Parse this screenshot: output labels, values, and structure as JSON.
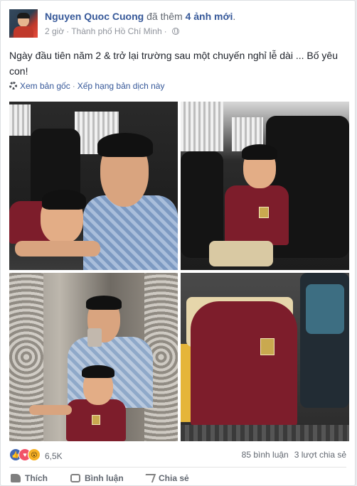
{
  "post": {
    "author": "Nguyen Quoc Cuong",
    "action_prefix": "đã thêm",
    "action_count": "4 ảnh mới",
    "action_suffix": ".",
    "time": "2 giờ",
    "location": "Thành phố Hồ Chí Minh",
    "privacy_icon": "globe-icon",
    "caption": "Ngày đầu tiên năm 2 & trở lại trường sau một chuyến nghỉ lễ dài ... Bố yêu con!"
  },
  "translation": {
    "see_original": "Xem bản gốc",
    "separator": "·",
    "rate_translation": "Xếp hạng bản dịch này"
  },
  "stats": {
    "reactions": [
      "like",
      "love",
      "wow"
    ],
    "reaction_count": "6,5K",
    "comments": "85 bình luận",
    "shares": "3 lượt chia sẻ"
  },
  "actions": {
    "like": "Thích",
    "comment": "Bình luận",
    "share": "Chia sẻ"
  },
  "colors": {
    "link": "#365899",
    "meta": "#90949c",
    "like": "#4267b2",
    "love": "#f25268",
    "wow": "#f7b125"
  }
}
